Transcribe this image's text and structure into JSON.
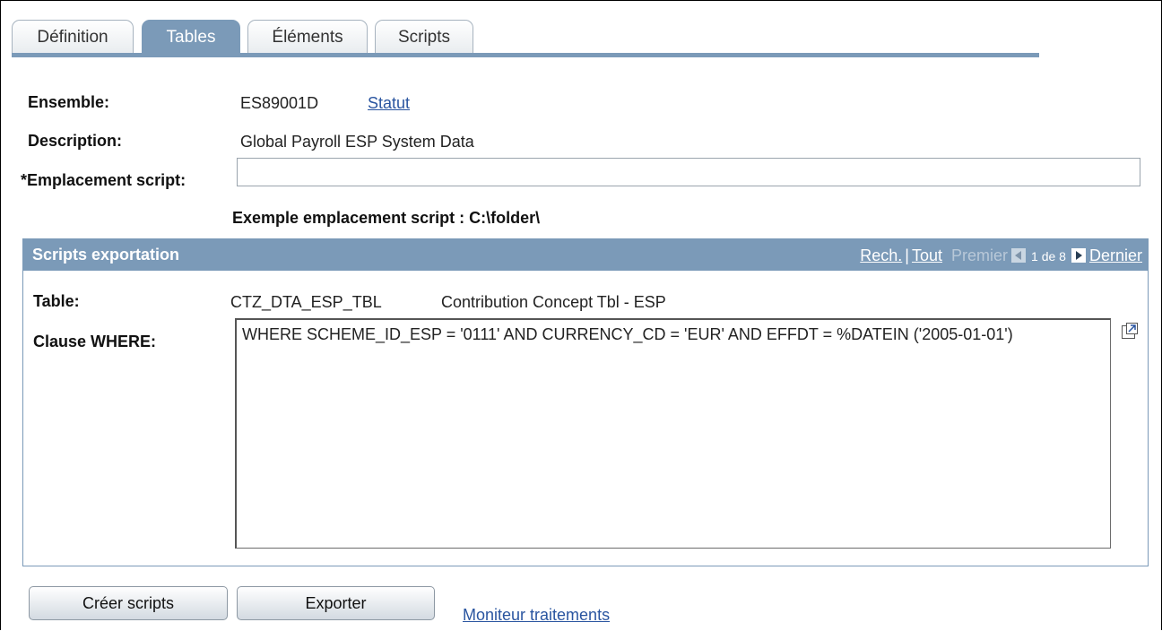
{
  "tabs": [
    {
      "label": "Définition",
      "active": false
    },
    {
      "label": "Tables",
      "active": true
    },
    {
      "label": "Éléments",
      "active": false
    },
    {
      "label": "Scripts",
      "active": false
    }
  ],
  "form": {
    "ensemble_label": "Ensemble:",
    "ensemble_value": "ES89001D",
    "statut_link": "Statut",
    "description_label": "Description:",
    "description_value": "Global Payroll ESP System Data",
    "script_location_label": "*Emplacement script:",
    "script_location_value": "",
    "example_text": "Exemple emplacement script : C:\\folder\\"
  },
  "grid": {
    "title": "Scripts exportation",
    "nav": {
      "find": "Rech.",
      "separator": "|",
      "all": "Tout",
      "first": "Premier",
      "count": "1 de 8",
      "last": "Dernier"
    },
    "table_label": "Table:",
    "table_name": "CTZ_DTA_ESP_TBL",
    "table_desc": "Contribution Concept Tbl - ESP",
    "where_label": "Clause WHERE:",
    "where_value": "WHERE SCHEME_ID_ESP = '0111' AND CURRENCY_CD = 'EUR' AND EFFDT = %DATEIN ('2005-01-01')"
  },
  "buttons": {
    "create_scripts": "Créer scripts",
    "export": "Exporter"
  },
  "links": {
    "process_monitor": "Moniteur traitements"
  },
  "colors": {
    "accent": "#7b9ab8",
    "link": "#2a55a0"
  }
}
